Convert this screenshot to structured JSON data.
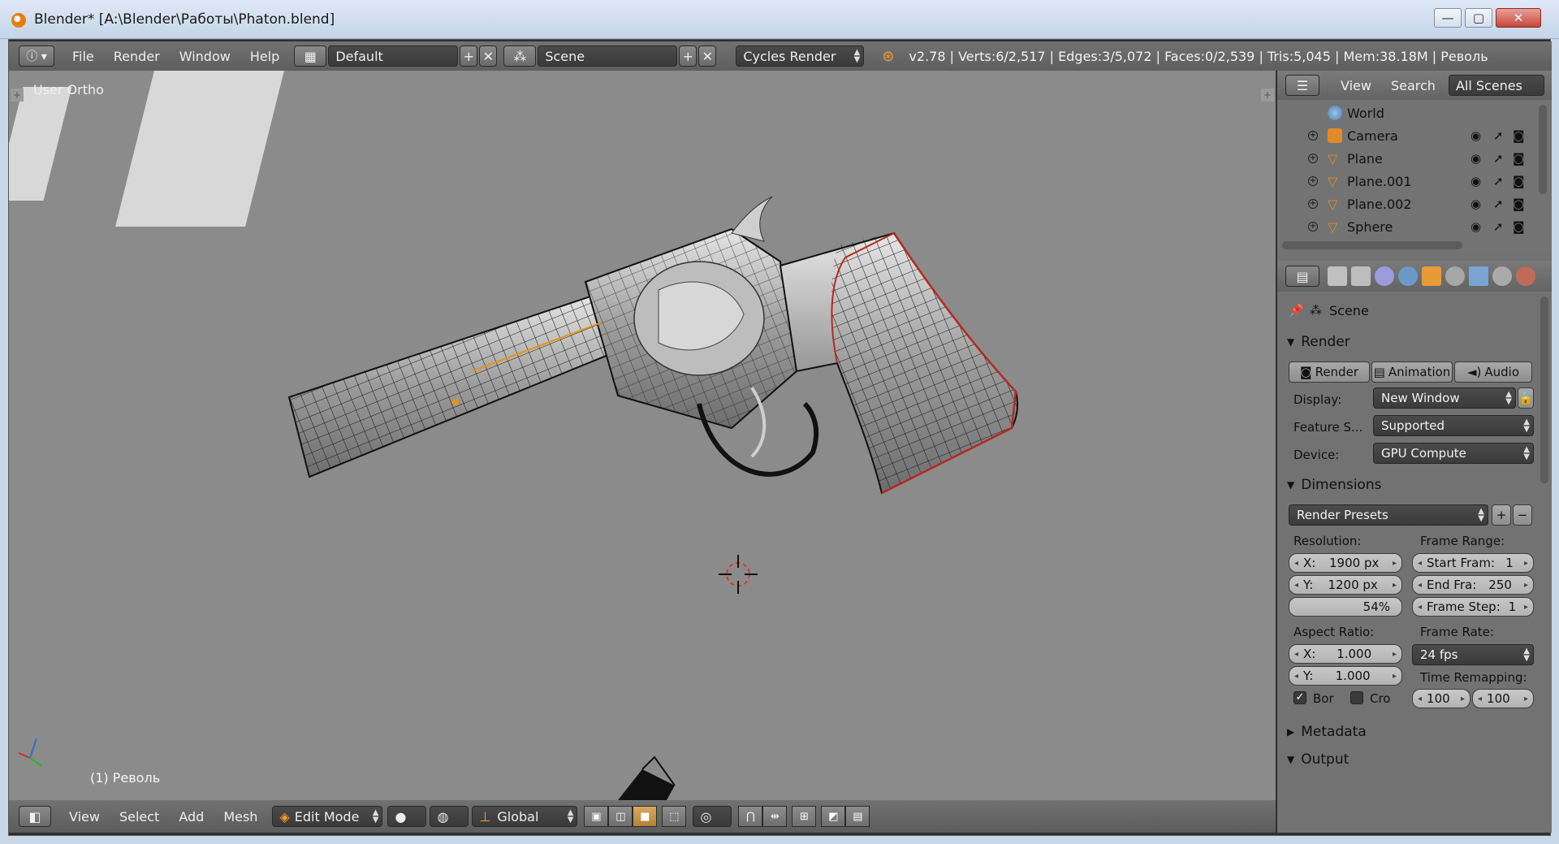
{
  "window": {
    "title": "Blender* [A:\\Blender\\Работы\\Phaton.blend]",
    "min": "—",
    "max": "▢",
    "close": "✕"
  },
  "info_header": {
    "menus": [
      "File",
      "Render",
      "Window",
      "Help"
    ],
    "layout": "Default",
    "scene": "Scene",
    "engine": "Cycles Render",
    "stats": "v2.78 | Verts:6/2,517 | Edges:3/5,072 | Faces:0/2,539 | Tris:5,045 | Mem:38.18M | Револь"
  },
  "viewport": {
    "view_label": "User Ortho",
    "object_label": "(1) Револь"
  },
  "viewport_header": {
    "menus": [
      "View",
      "Select",
      "Add",
      "Mesh"
    ],
    "mode": "Edit Mode",
    "orientation": "Global"
  },
  "outliner": {
    "tabs": [
      "View",
      "Search",
      "All Scenes"
    ],
    "rows": [
      {
        "name": "World",
        "icon": "world-icon"
      },
      {
        "name": "Camera",
        "icon": "camera-icon"
      },
      {
        "name": "Plane",
        "icon": "mesh-icon"
      },
      {
        "name": "Plane.001",
        "icon": "mesh-icon"
      },
      {
        "name": "Plane.002",
        "icon": "mesh-icon"
      },
      {
        "name": "Sphere",
        "icon": "mesh-icon"
      }
    ]
  },
  "properties": {
    "context": "Scene",
    "render": {
      "title": "Render",
      "buttons": [
        "Render",
        "Animation",
        "Audio"
      ],
      "display_label": "Display:",
      "display": "New Window",
      "feature_label": "Feature S...",
      "feature": "Supported",
      "device_label": "Device:",
      "device": "GPU Compute"
    },
    "dimensions": {
      "title": "Dimensions",
      "presets": "Render Presets",
      "resolution_label": "Resolution:",
      "res_x": "1900 px",
      "res_y": "1200 px",
      "res_pct": "54%",
      "frame_range_label": "Frame Range:",
      "start": "1",
      "end": "250",
      "step": "1",
      "start_label": "Start Fram:",
      "end_label": "End Fra:",
      "step_label": "Frame Step:",
      "aspect_label": "Aspect Ratio:",
      "aspect_x": "1.000",
      "aspect_y": "1.000",
      "frame_rate_label": "Frame Rate:",
      "frame_rate": "24 fps",
      "time_remap_label": "Time Remapping:",
      "remap_old": "100",
      "remap_new": "100",
      "border_label": "Bor",
      "crop_label": "Cro",
      "x_label": "X:",
      "y_label": "Y:"
    },
    "metadata_title": "Metadata",
    "output_title": "Output"
  }
}
